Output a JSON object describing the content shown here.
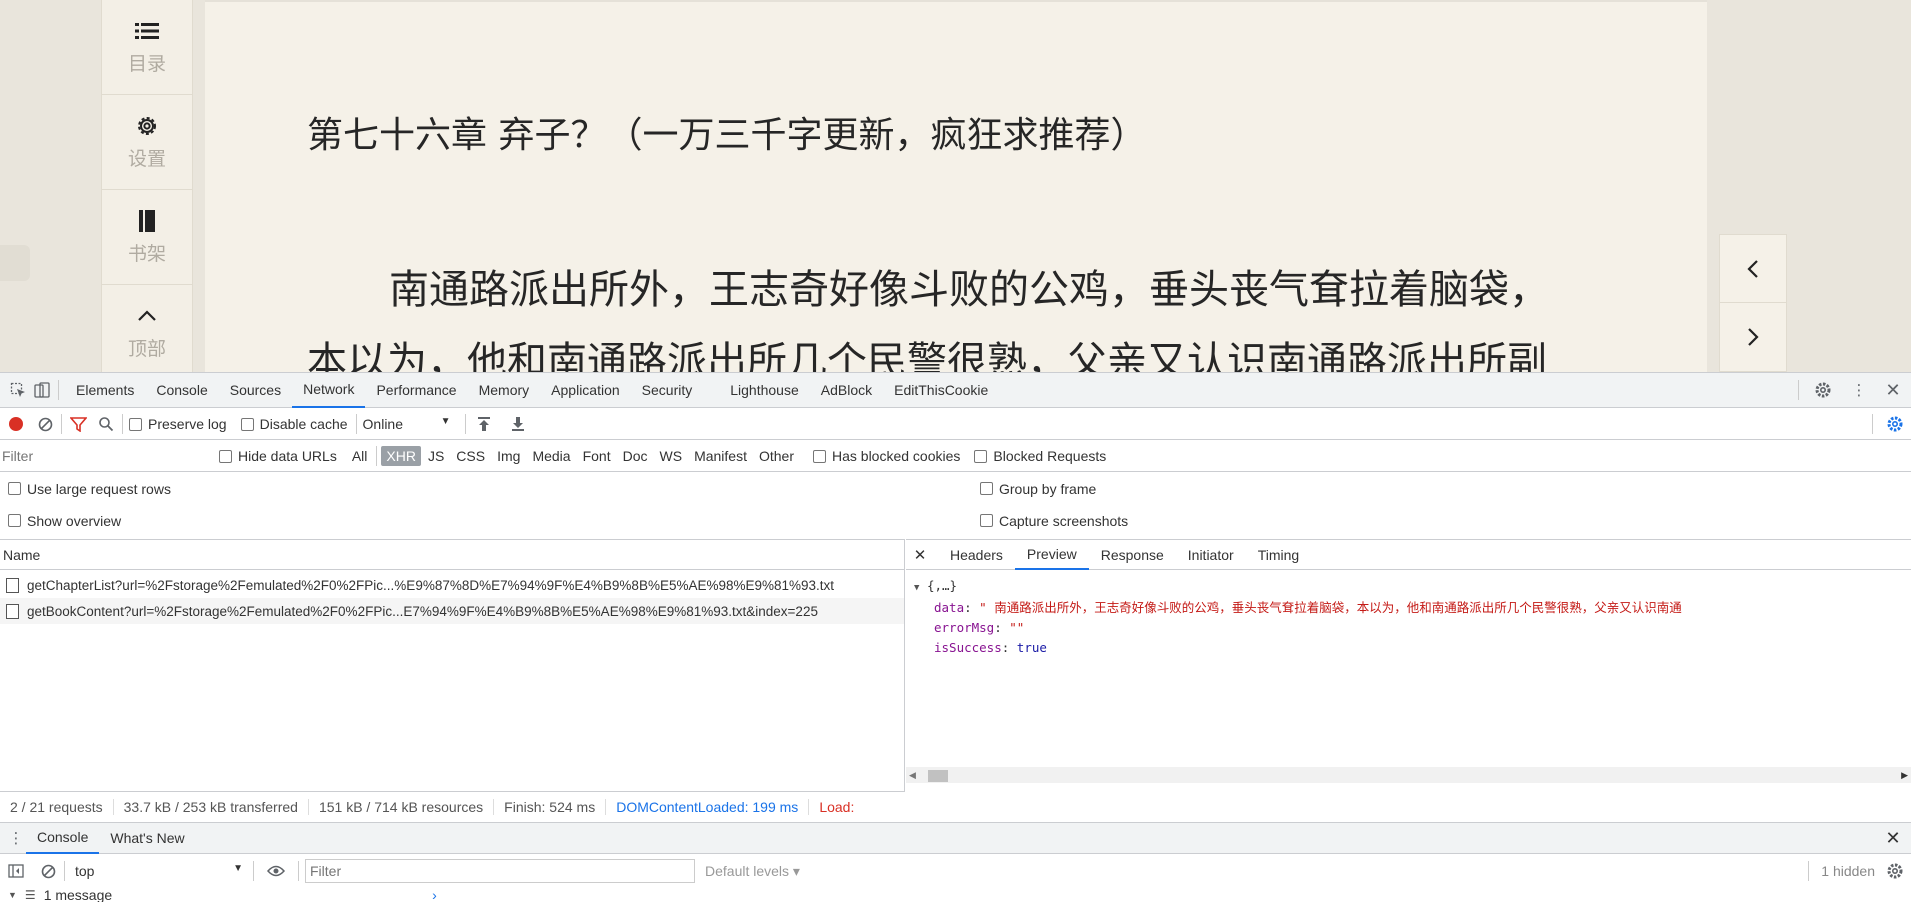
{
  "reader": {
    "sidebar": [
      {
        "label": "目录",
        "icon": "list-icon"
      },
      {
        "label": "设置",
        "icon": "gear-icon"
      },
      {
        "label": "书架",
        "icon": "book-icon"
      },
      {
        "label": "顶部",
        "icon": "chevron-up-icon"
      }
    ],
    "chapter_title": "第七十六章 弃子？（一万三千字更新，疯狂求推荐）",
    "paragraphs": [
      "南通路派出所外，王志奇好像斗败的公鸡，垂头丧气耷拉着脑袋，",
      "本以为，他和南通路派出所几个民警很熟，父亲又认识南通路派出所副"
    ],
    "nav": {
      "prev": "‹",
      "next": "›"
    }
  },
  "devtools": {
    "tabs": [
      "Elements",
      "Console",
      "Sources",
      "Network",
      "Performance",
      "Memory",
      "Application",
      "Security",
      "Lighthouse",
      "AdBlock",
      "EditThisCookie"
    ],
    "active_tab": "Network",
    "toolbar": {
      "preserve_log": "Preserve log",
      "disable_cache": "Disable cache",
      "throttle": "Online"
    },
    "filter": {
      "placeholder": "Filter",
      "hide_data_urls": "Hide data URLs",
      "types": [
        "All",
        "XHR",
        "JS",
        "CSS",
        "Img",
        "Media",
        "Font",
        "Doc",
        "WS",
        "Manifest",
        "Other"
      ],
      "active_type": "XHR",
      "has_blocked_cookies": "Has blocked cookies",
      "blocked_requests": "Blocked Requests"
    },
    "options": {
      "large_rows": "Use large request rows",
      "group_by_frame": "Group by frame",
      "show_overview": "Show overview",
      "capture_screenshots": "Capture screenshots"
    },
    "name_header": "Name",
    "requests": [
      "getChapterList?url=%2Fstorage%2Femulated%2F0%2FPic...%E9%87%8D%E7%94%9F%E4%B9%8B%E5%AE%98%E9%81%93.txt",
      "getBookContent?url=%2Fstorage%2Femulated%2F0%2FPic...E7%94%9F%E4%B9%8B%E5%AE%98%E9%81%93.txt&index=225"
    ],
    "preview_tabs": [
      "Headers",
      "Preview",
      "Response",
      "Initiator",
      "Timing"
    ],
    "active_preview_tab": "Preview",
    "json": {
      "root": "{,…}",
      "data_key": "data",
      "data_value": "\"    南通路派出所外，王志奇好像斗败的公鸡，垂头丧气耷拉着脑袋，本以为，他和南通路派出所几个民警很熟，父亲又认识南通",
      "errorMsg_key": "errorMsg",
      "errorMsg_value": "\"\"",
      "isSuccess_key": "isSuccess",
      "isSuccess_value": "true"
    },
    "status": {
      "requests": "2 / 21 requests",
      "transferred": "33.7 kB / 253 kB transferred",
      "resources": "151 kB / 714 kB resources",
      "finish": "Finish: 524 ms",
      "dom": "DOMContentLoaded: 199 ms",
      "load": "Load:"
    },
    "drawer": {
      "tabs": [
        "Console",
        "What's New"
      ],
      "context": "top",
      "filter_placeholder": "Filter",
      "levels": "Default levels ▾",
      "hidden": "1 hidden",
      "message": "1 message"
    }
  }
}
